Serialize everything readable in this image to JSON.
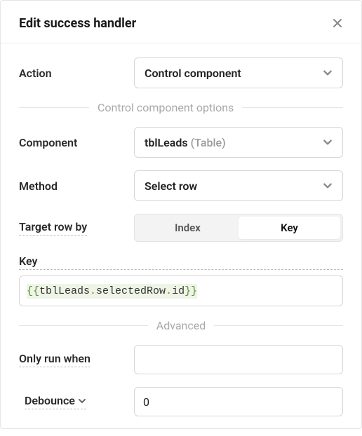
{
  "header": {
    "title": "Edit success handler"
  },
  "action": {
    "label": "Action",
    "value": "Control component"
  },
  "section1": {
    "title": "Control component options"
  },
  "component": {
    "label": "Component",
    "value_primary": "tblLeads",
    "value_secondary": " (Table)"
  },
  "method": {
    "label": "Method",
    "value": "Select row"
  },
  "targetRowBy": {
    "label": "Target row by",
    "options": {
      "index": "Index",
      "key": "Key"
    },
    "selected": "key"
  },
  "key": {
    "label": "Key",
    "expr": {
      "open": "{{",
      "obj": "tblLeads",
      "d1": ".",
      "p1": "selectedRow",
      "d2": ".",
      "p2": "id",
      "close": "}}"
    }
  },
  "section2": {
    "title": "Advanced"
  },
  "onlyRunWhen": {
    "label": "Only run when",
    "value": ""
  },
  "debounce": {
    "label": "Debounce",
    "value": "0"
  }
}
